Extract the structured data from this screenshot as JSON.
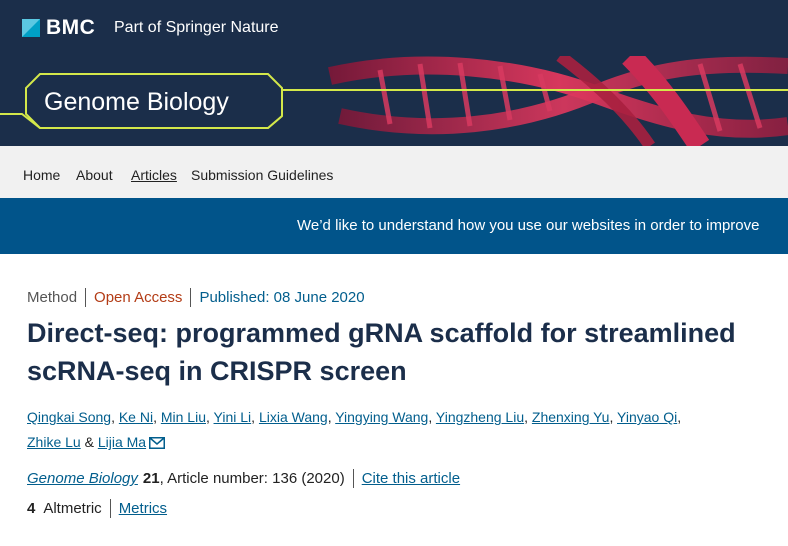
{
  "header": {
    "logo_text": "BMC",
    "tagline": "Part of Springer Nature",
    "accent_color": "#1b2e4a"
  },
  "banner": {
    "journal_title": "Genome Biology",
    "frame_color": "#d4e84a"
  },
  "nav": {
    "items": [
      {
        "label": "Home"
      },
      {
        "label": "About"
      },
      {
        "label": "Articles"
      },
      {
        "label": "Submission Guidelines"
      }
    ],
    "active": "Articles"
  },
  "survey": {
    "text": "We’d like to understand how you use our websites in order to improve"
  },
  "article": {
    "type": "Method",
    "access": "Open Access",
    "published": "Published: 08 June 2020",
    "title": "Direct-seq: programmed gRNA scaffold for streamlined scRNA-seq in CRISPR screen",
    "authors": [
      "Qingkai Song",
      "Ke Ni",
      "Min Liu",
      "Yini Li",
      "Lixia Wang",
      "Yingying Wang",
      "Yingzheng Liu",
      "Zhenxing Yu",
      "Yinyao Qi",
      "Zhike Lu",
      "Lijia Ma"
    ],
    "author_conjunction": "&",
    "journal": "Genome Biology",
    "volume": "21",
    "article_number": ", Article number: 136 (2020)",
    "cite_label": "Cite this article",
    "altmetric_count": "4",
    "altmetric_label": "Altmetric",
    "metrics_label": "Metrics"
  },
  "icons": {
    "bmc_logo": "bmc-square-icon",
    "mail": "envelope-icon"
  }
}
